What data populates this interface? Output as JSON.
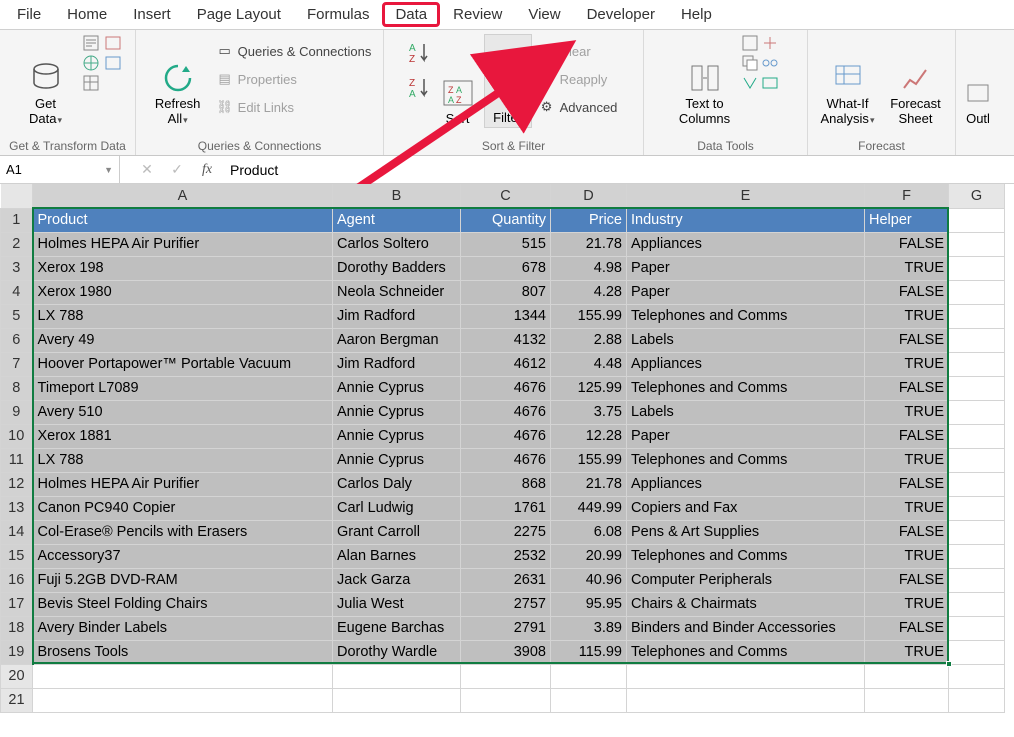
{
  "tabs": [
    "File",
    "Home",
    "Insert",
    "Page Layout",
    "Formulas",
    "Data",
    "Review",
    "View",
    "Developer",
    "Help"
  ],
  "active_tab": "Data",
  "ribbon": {
    "get_data": {
      "label": "Get\nData",
      "group": "Get & Transform Data"
    },
    "refresh": {
      "label": "Refresh\nAll",
      "group": "Queries & Connections",
      "items": [
        "Queries & Connections",
        "Properties",
        "Edit Links"
      ]
    },
    "sort": {
      "label": "Sort",
      "za_down": "",
      "group": "Sort & Filter"
    },
    "filter": {
      "label": "Filter",
      "items": [
        "Clear",
        "Reapply",
        "Advanced"
      ]
    },
    "ttc": {
      "label": "Text to\nColumns",
      "group": "Data Tools"
    },
    "whatif": {
      "label": "What-If\nAnalysis",
      "forecast": "Forecast\nSheet",
      "group": "Forecast"
    },
    "outline": {
      "label": "Outl"
    }
  },
  "namebox": "A1",
  "formula": "Product",
  "columns": [
    "A",
    "B",
    "C",
    "D",
    "E",
    "F",
    "G"
  ],
  "headers": {
    "A": "Product",
    "B": "Agent",
    "C": "Quantity",
    "D": "Price",
    "E": "Industry",
    "F": "Helper"
  },
  "rows": [
    {
      "n": 2,
      "A": "Holmes HEPA Air Purifier",
      "B": "Carlos Soltero",
      "C": 515,
      "D": "21.78",
      "E": "Appliances",
      "F": "FALSE"
    },
    {
      "n": 3,
      "A": "Xerox 198",
      "B": "Dorothy Badders",
      "C": 678,
      "D": "4.98",
      "E": "Paper",
      "F": "TRUE"
    },
    {
      "n": 4,
      "A": "Xerox 1980",
      "B": "Neola Schneider",
      "C": 807,
      "D": "4.28",
      "E": "Paper",
      "F": "FALSE"
    },
    {
      "n": 5,
      "A": "LX 788",
      "B": "Jim Radford",
      "C": 1344,
      "D": "155.99",
      "E": "Telephones and Comms",
      "F": "TRUE"
    },
    {
      "n": 6,
      "A": "Avery 49",
      "B": "Aaron Bergman",
      "C": 4132,
      "D": "2.88",
      "E": "Labels",
      "F": "FALSE"
    },
    {
      "n": 7,
      "A": "Hoover Portapower™ Portable Vacuum",
      "B": "Jim Radford",
      "C": 4612,
      "D": "4.48",
      "E": "Appliances",
      "F": "TRUE"
    },
    {
      "n": 8,
      "A": "Timeport L7089",
      "B": "Annie Cyprus",
      "C": 4676,
      "D": "125.99",
      "E": "Telephones and Comms",
      "F": "FALSE"
    },
    {
      "n": 9,
      "A": "Avery 510",
      "B": "Annie Cyprus",
      "C": 4676,
      "D": "3.75",
      "E": "Labels",
      "F": "TRUE"
    },
    {
      "n": 10,
      "A": "Xerox 1881",
      "B": "Annie Cyprus",
      "C": 4676,
      "D": "12.28",
      "E": "Paper",
      "F": "FALSE"
    },
    {
      "n": 11,
      "A": "LX 788",
      "B": "Annie Cyprus",
      "C": 4676,
      "D": "155.99",
      "E": "Telephones and Comms",
      "F": "TRUE"
    },
    {
      "n": 12,
      "A": "Holmes HEPA Air Purifier",
      "B": "Carlos Daly",
      "C": 868,
      "D": "21.78",
      "E": "Appliances",
      "F": "FALSE"
    },
    {
      "n": 13,
      "A": "Canon PC940 Copier",
      "B": "Carl Ludwig",
      "C": 1761,
      "D": "449.99",
      "E": "Copiers and Fax",
      "F": "TRUE"
    },
    {
      "n": 14,
      "A": "Col-Erase® Pencils with Erasers",
      "B": "Grant Carroll",
      "C": 2275,
      "D": "6.08",
      "E": "Pens & Art Supplies",
      "F": "FALSE"
    },
    {
      "n": 15,
      "A": "Accessory37",
      "B": "Alan Barnes",
      "C": 2532,
      "D": "20.99",
      "E": "Telephones and Comms",
      "F": "TRUE"
    },
    {
      "n": 16,
      "A": "Fuji 5.2GB DVD-RAM",
      "B": "Jack Garza",
      "C": 2631,
      "D": "40.96",
      "E": "Computer Peripherals",
      "F": "FALSE"
    },
    {
      "n": 17,
      "A": "Bevis Steel Folding Chairs",
      "B": "Julia West",
      "C": 2757,
      "D": "95.95",
      "E": "Chairs & Chairmats",
      "F": "TRUE"
    },
    {
      "n": 18,
      "A": "Avery Binder Labels",
      "B": "Eugene Barchas",
      "C": 2791,
      "D": "3.89",
      "E": "Binders and Binder Accessories",
      "F": "FALSE"
    },
    {
      "n": 19,
      "A": "Brosens Tools",
      "B": "Dorothy Wardle",
      "C": 3908,
      "D": "115.99",
      "E": "Telephones and Comms",
      "F": "TRUE"
    }
  ],
  "empty_rows": [
    20,
    21
  ]
}
